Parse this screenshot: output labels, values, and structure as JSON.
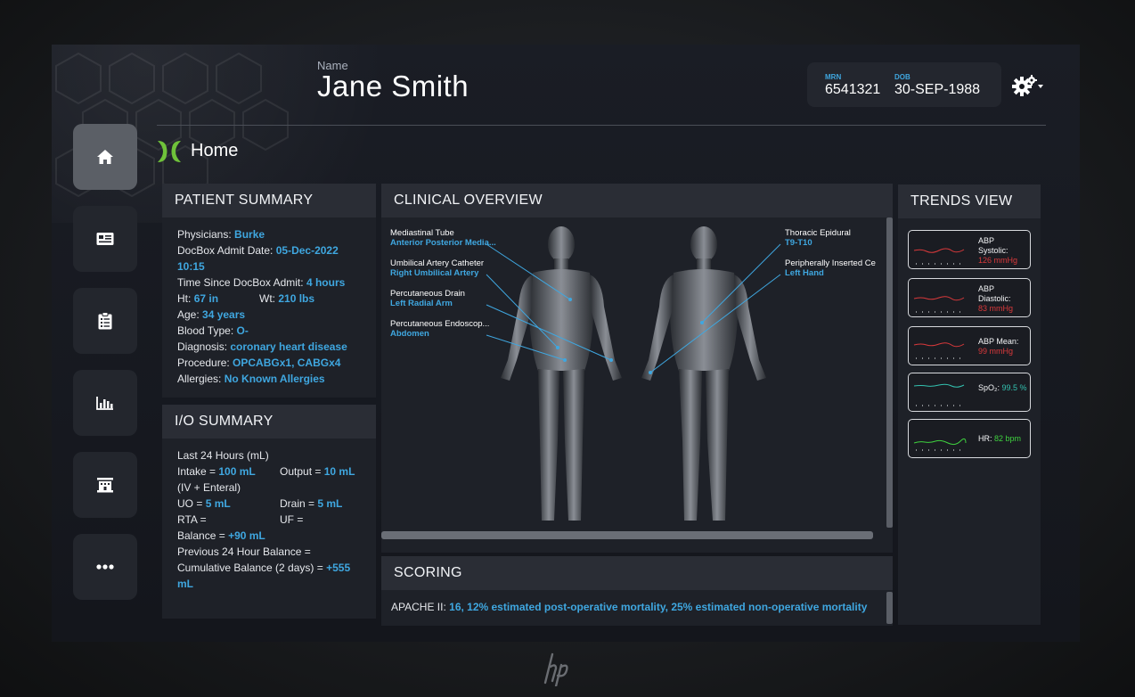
{
  "header": {
    "name_label": "Name",
    "name": "Jane Smith",
    "mrn_label": "MRN",
    "mrn": "6541321",
    "dob_label": "DOB",
    "dob": "30-SEP-1988"
  },
  "sidebar": {
    "items": [
      {
        "icon": "home-icon",
        "active": true
      },
      {
        "icon": "id-card-icon",
        "active": false
      },
      {
        "icon": "clipboard-icon",
        "active": false
      },
      {
        "icon": "bar-chart-icon",
        "active": false
      },
      {
        "icon": "building-icon",
        "active": false
      },
      {
        "icon": "more-icon",
        "active": false
      }
    ]
  },
  "page": {
    "title": "Home"
  },
  "patient_summary": {
    "title": "PATIENT SUMMARY",
    "physicians_label": "Physicians:",
    "physicians": "Burke",
    "admit_label": "DocBox Admit Date:",
    "admit_date": "05-Dec-2022",
    "admit_time": "10:15",
    "time_since_label": "Time Since DocBox Admit:",
    "time_since": "4 hours",
    "ht_label": "Ht:",
    "ht": "67 in",
    "wt_label": "Wt:",
    "wt": "210 lbs",
    "age_label": "Age:",
    "age": "34 years",
    "blood_label": "Blood Type:",
    "blood": "O-",
    "diagnosis_label": "Diagnosis:",
    "diagnosis": "coronary heart disease",
    "procedure_label": "Procedure:",
    "procedure": "OPCABGx1, CABGx4",
    "allergies_label": "Allergies:",
    "allergies": "No Known Allergies"
  },
  "io_summary": {
    "title": "I/O SUMMARY",
    "period": "Last 24 Hours (mL)",
    "intake_label": "Intake =",
    "intake": "100 mL",
    "output_label": "Output =",
    "output": "10 mL",
    "intake_note": "(IV + Enteral)",
    "uo_label": "UO =",
    "uo": "5 mL",
    "drain_label": "Drain =",
    "drain": "5 mL",
    "rta_label": "RTA =",
    "uf_label": "UF =",
    "balance_label": "Balance =",
    "balance": "+90 mL",
    "prev_label": "Previous 24 Hour Balance =",
    "cumulative_label": "Cumulative Balance (2 days) =",
    "cumulative_1": "+555",
    "cumulative_2": "mL"
  },
  "clinical_overview": {
    "title": "CLINICAL OVERVIEW",
    "annotations": [
      {
        "name": "Mediastinal Tube",
        "site": "Anterior Posterior Media..."
      },
      {
        "name": "Umbilical Artery Catheter",
        "site": "Right Umbilical Artery"
      },
      {
        "name": "Percutaneous Drain",
        "site": "Left Radial Arm"
      },
      {
        "name": "Percutaneous Endoscop...",
        "site": "Abdomen"
      },
      {
        "name": "Thoracic Epidural",
        "site": "T9-T10"
      },
      {
        "name": "Peripherally Inserted Ce",
        "site": "Left Hand"
      }
    ]
  },
  "scoring": {
    "title": "SCORING",
    "apache_label": "APACHE II:",
    "apache_value": "16, 12% estimated post-operative mortality, 25% estimated non-operative mortality"
  },
  "trends": {
    "title": "TRENDS VIEW",
    "items": [
      {
        "label_1": "ABP",
        "label_2": "Systolic:",
        "value": "126 mmHg",
        "color": "#d9393b"
      },
      {
        "label_1": "ABP",
        "label_2": "Diastolic:",
        "value": "83 mmHg",
        "color": "#d9393b"
      },
      {
        "label_1": "ABP Mean:",
        "label_2": "",
        "value": "99 mmHg",
        "color": "#d9393b"
      },
      {
        "label_1": "SpO₂:",
        "label_2": "",
        "value": "99.5 %",
        "color": "#33c2b0"
      },
      {
        "label_1": "HR:",
        "label_2": "",
        "value": "82 bpm",
        "color": "#3fd23f"
      }
    ]
  }
}
